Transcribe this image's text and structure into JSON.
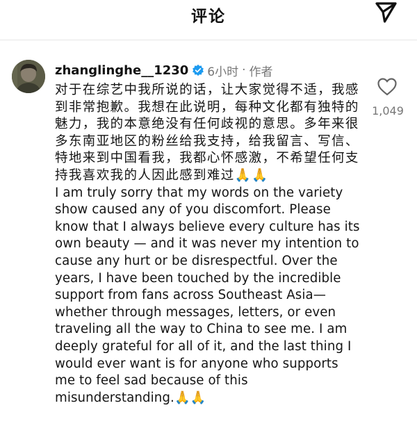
{
  "header": {
    "title": "评论",
    "share_icon": "paper-plane-icon"
  },
  "comment": {
    "username": "zhanglinghe__1230",
    "verified_icon": "verified-badge-icon",
    "time": "6小时",
    "separator": "·",
    "author_label": "作者",
    "text_zh": "对于在综艺中我所说的话，让大家觉得不适，我感到非常抱歉。我想在此说明，每种文化都有独特的魅力，我的本意绝没有任何歧视的意思。多年来很多东南亚地区的粉丝给我支持，给我留言、写信、特地来到中国看我，我都心怀感激，不希望任何支持我喜欢我的人因此感到难过🙏🙏",
    "text_en": "I am truly sorry that my words on the variety show caused any of you discomfort. Please know that I always believe every culture has its own beauty — and it was never my intention to cause any hurt or be disrespectful. Over the years, I have been touched by the incredible support from fans across Southeast Asia—whether through messages, letters, or even traveling all the way to China to see me. I am deeply grateful for all of it, and the last thing I would ever want is for anyone who supports me to feel sad because of this misunderstanding.🙏🙏",
    "like_icon": "heart-icon",
    "like_count": "1,049"
  },
  "colors": {
    "text": "#111111",
    "muted": "#777777",
    "verified": "#1d9bf0"
  }
}
